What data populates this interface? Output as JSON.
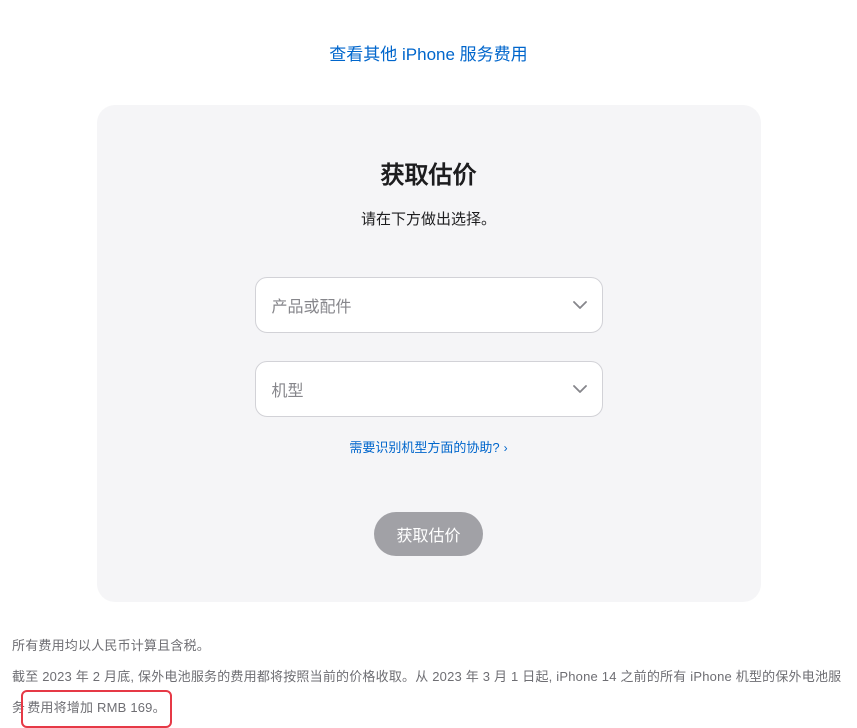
{
  "top_link": "查看其他 iPhone 服务费用",
  "card": {
    "title": "获取估价",
    "subtitle": "请在下方做出选择。",
    "select_product_placeholder": "产品或配件",
    "select_model_placeholder": "机型",
    "help_link": "需要识别机型方面的协助?",
    "submit_label": "获取估价"
  },
  "footer": {
    "line1": "所有费用均以人民币计算且含税。",
    "line2_part1": "截至 2023 年 2 月底, 保外电池服务的费用都将按照当前的价格收取。从 2023 年 3 月 1 日起, iPhone 14 之前的所有 iPhone 机型的保外电池服",
    "line2_part2_pre": "务",
    "line2_highlight": "费用将增加 RMB 169。"
  }
}
